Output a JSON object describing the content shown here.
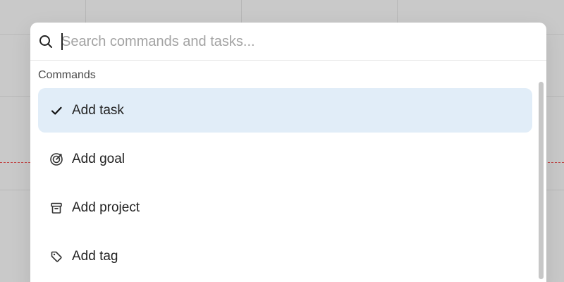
{
  "command_palette": {
    "search": {
      "placeholder": "Search commands and tasks...",
      "value": ""
    },
    "section_label": "Commands",
    "items": [
      {
        "label": "Add task",
        "icon": "check-icon",
        "selected": true
      },
      {
        "label": "Add goal",
        "icon": "target-icon",
        "selected": false
      },
      {
        "label": "Add project",
        "icon": "archive-box-icon",
        "selected": false
      },
      {
        "label": "Add tag",
        "icon": "tag-icon",
        "selected": false
      }
    ]
  },
  "colors": {
    "overlay_background": "#c9c9c9",
    "modal_background": "#ffffff",
    "selected_item_background": "#e1edf8",
    "now_line": "#c23a3a",
    "scrollbar_thumb": "#c7c7c7"
  }
}
